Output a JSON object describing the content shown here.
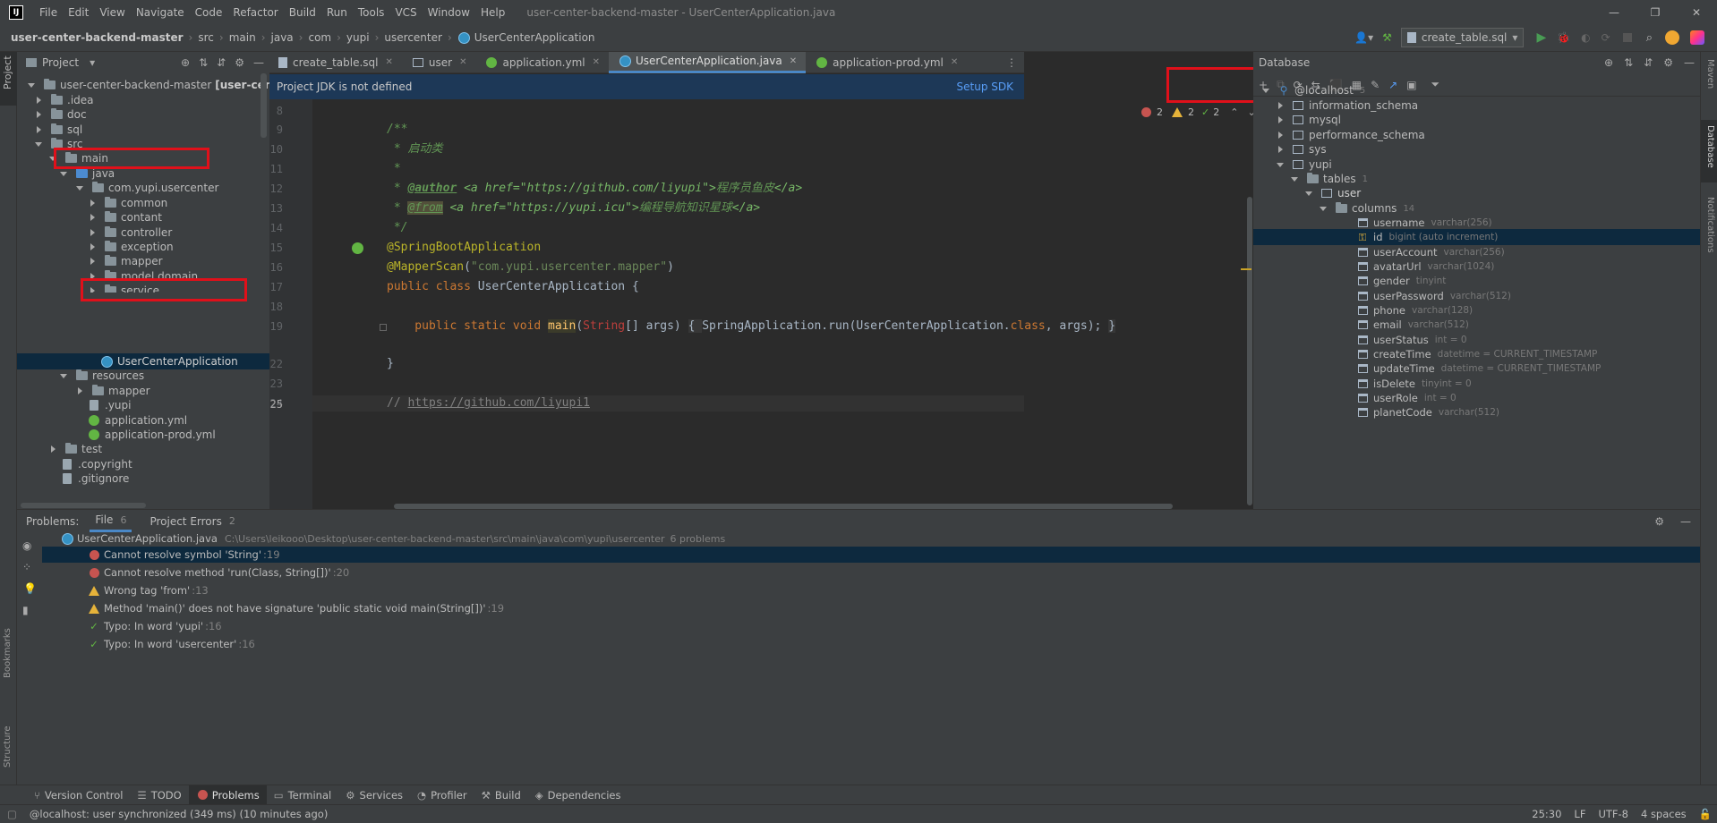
{
  "menu": {
    "items": [
      "File",
      "Edit",
      "View",
      "Navigate",
      "Code",
      "Refactor",
      "Build",
      "Run",
      "Tools",
      "VCS",
      "Window",
      "Help"
    ],
    "title": "user-center-backend-master - UserCenterApplication.java"
  },
  "nav": {
    "crumbs": [
      "user-center-backend-master",
      "src",
      "main",
      "java",
      "com",
      "yupi",
      "usercenter",
      "UserCenterApplication"
    ],
    "run_config": "create_table.sql"
  },
  "project": {
    "header": "Project",
    "root": "user-center-backend-master",
    "root_module": "[user-center-backend]",
    "root_tail": "C:",
    "items": [
      ".idea",
      "doc",
      "sql",
      "src",
      "main",
      "java",
      "com.yupi.usercenter",
      "common",
      "contant",
      "controller",
      "exception",
      "mapper",
      "model.domain",
      "service",
      "UserCenterApplication",
      "resources",
      "mapper",
      ".yupi",
      "application.yml",
      "application-prod.yml",
      "test",
      ".copyright",
      ".gitignore"
    ]
  },
  "tabs": [
    "create_table.sql",
    "user",
    "application.yml",
    "UserCenterApplication.java",
    "application-prod.yml"
  ],
  "banner": {
    "text": "Project JDK is not defined",
    "action": "Setup SDK"
  },
  "inspections": {
    "errors": "2",
    "warnings": "2",
    "ok": "2"
  },
  "code": {
    "line_numbers": [
      "8",
      "9",
      "10",
      "11",
      "12",
      "13",
      "14",
      "15",
      "16",
      "17",
      "18",
      "19",
      "22",
      "23",
      "24",
      "25"
    ],
    "c1": "/**",
    "c2a": " * ",
    "c2b": "启动类",
    "c3": " *",
    "c4a": " * ",
    "c4b": "@author",
    "c4c": " <a href=\"https://github.com/liyupi\">",
    "c4d": "程序员鱼皮",
    "c4e": "</a>",
    "c5a": " * ",
    "c5b": "@from",
    "c5c": " <a href=\"https://yupi.icu\">",
    "c5d": "编程导航知识星球",
    "c5e": "</a>",
    "c6": " */",
    "a1": "@SpringBootApplication",
    "a2": "@MapperScan",
    "a2b": "(",
    "a2c": "\"com.yupi.usercenter.mapper\"",
    "a2d": ")",
    "k1": "public class ",
    "n1": "UserCenterApplication",
    " b1": " {",
    "m1": "    public static void ",
    "m2": "main",
    "m3": "(",
    "m4": "String",
    "m5": "[] args) ",
    "m6": "{ ",
    "m7": "SpringApplication.run(UserCenterApplication.",
    "m8": "class",
    "m9": ", args); ",
    "m10": "}",
    "close": "}",
    "cm1": "// ",
    "cm2": "https://github.com/liyupi1"
  },
  "database": {
    "header": "Database",
    "host": "@localhost",
    "host_count": "5",
    "schemas": [
      "information_schema",
      "mysql",
      "performance_schema",
      "sys",
      "yupi"
    ],
    "tables_label": "tables",
    "tables_count": "1",
    "table": "user",
    "columns_label": "columns",
    "columns_count": "14",
    "columns": [
      [
        "username",
        "varchar(256)"
      ],
      [
        "id",
        "bigint (auto increment)"
      ],
      [
        "userAccount",
        "varchar(256)"
      ],
      [
        "avatarUrl",
        "varchar(1024)"
      ],
      [
        "gender",
        "tinyint"
      ],
      [
        "userPassword",
        "varchar(512)"
      ],
      [
        "phone",
        "varchar(128)"
      ],
      [
        "email",
        "varchar(512)"
      ],
      [
        "userStatus",
        "int = 0"
      ],
      [
        "createTime",
        "datetime = CURRENT_TIMESTAMP"
      ],
      [
        "updateTime",
        "datetime = CURRENT_TIMESTAMP"
      ],
      [
        "isDelete",
        "tinyint = 0"
      ],
      [
        "userRole",
        "int = 0"
      ],
      [
        "planetCode",
        "varchar(512)"
      ]
    ]
  },
  "problems": {
    "label": "Problems:",
    "tab_file": "File",
    "file_count": "6",
    "tab_project": "Project Errors",
    "project_count": "2",
    "file": "UserCenterApplication.java",
    "path": "C:\\Users\\leikooo\\Desktop\\user-center-backend-master\\src\\main\\java\\com\\yupi\\usercenter",
    "count": "6 problems",
    "items": [
      [
        "Cannot resolve symbol 'String'",
        ":19"
      ],
      [
        "Cannot resolve method 'run(Class, String[])'",
        ":20"
      ],
      [
        "Wrong tag 'from'",
        ":13"
      ],
      [
        "Method 'main()' does not have signature 'public static void main(String[])'",
        ":19"
      ],
      [
        "Typo: In word 'yupi'",
        ":16"
      ],
      [
        "Typo: In word 'usercenter'",
        ":16"
      ]
    ]
  },
  "side": {
    "project": "Project",
    "bookmarks": "Bookmarks",
    "structure": "Structure",
    "maven": "Maven",
    "database": "Database",
    "notifications": "Notifications"
  },
  "bottom_tabs": [
    "Version Control",
    "TODO",
    "Problems",
    "Terminal",
    "Services",
    "Profiler",
    "Build",
    "Dependencies"
  ],
  "status": {
    "message": "@localhost: user synchronized (349 ms) (10 minutes ago)",
    "position": "25:30",
    "eol": "LF",
    "encoding": "UTF-8",
    "indent": "4 spaces"
  }
}
